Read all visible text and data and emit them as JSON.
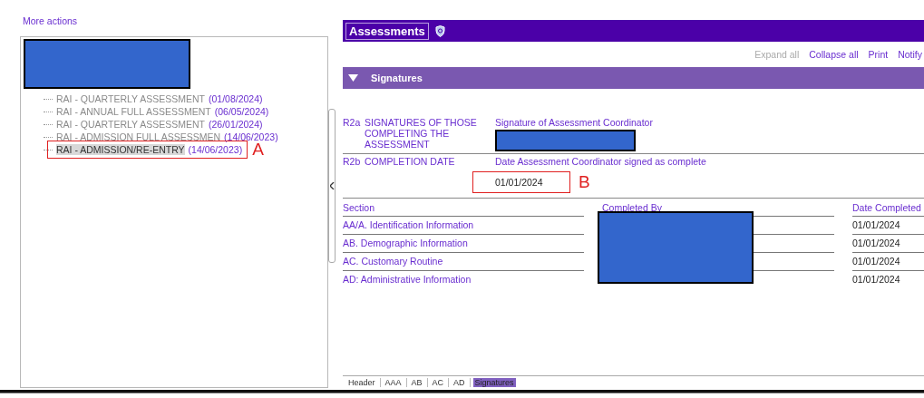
{
  "more_actions": "More actions",
  "tree": [
    {
      "name": "RAI - QUARTERLY ASSESSMENT",
      "date": "(01/08/2024)",
      "selected": false
    },
    {
      "name": "RAI - ANNUAL FULL ASSESSMENT",
      "date": "(06/05/2024)",
      "selected": false
    },
    {
      "name": "RAI - QUARTERLY ASSESSMENT",
      "date": "(26/01/2024)",
      "selected": false
    },
    {
      "name": "RAI - ADMISSION FULL ASSESSMEN",
      "date": "(14/06/2023)",
      "selected": false
    },
    {
      "name": "RAI - ADMISSION/RE-ENTRY",
      "date": "(14/06/2023)",
      "selected": true,
      "annotation": "A"
    }
  ],
  "header": {
    "title": "Assessments"
  },
  "toolbar": [
    {
      "label": "Expand all",
      "disabled": true
    },
    {
      "label": "Collapse all",
      "disabled": false
    },
    {
      "label": "Print",
      "disabled": false
    },
    {
      "label": "Notify",
      "disabled": false
    }
  ],
  "section": {
    "title": "Signatures",
    "expanded": true
  },
  "fields": [
    {
      "code": "R2a",
      "label": "SIGNATURES OF THOSE COMPLETING THE ASSESSMENT",
      "caption": "Signature of Assessment Coordinator"
    },
    {
      "code": "R2b",
      "label": "COMPLETION DATE",
      "caption": "Date Assessment Coordinator signed as complete",
      "value": "01/01/2024",
      "annotation": "B"
    }
  ],
  "table": {
    "columns": [
      "Section",
      "Completed By",
      "Date Completed"
    ],
    "rows": [
      {
        "section": "AA/A. Identification Information",
        "date": "01/01/2024"
      },
      {
        "section": "AB. Demographic Information",
        "date": "01/01/2024"
      },
      {
        "section": "AC. Customary Routine",
        "date": "01/01/2024"
      },
      {
        "section": "AD: Administrative Information",
        "date": "01/01/2024"
      }
    ]
  },
  "bottom_tabs": [
    {
      "label": "Header",
      "selected": false
    },
    {
      "label": "AAA",
      "selected": false
    },
    {
      "label": "AB",
      "selected": false
    },
    {
      "label": "AC",
      "selected": false
    },
    {
      "label": "AD",
      "selected": false
    },
    {
      "label": "Signatures",
      "selected": true
    }
  ]
}
